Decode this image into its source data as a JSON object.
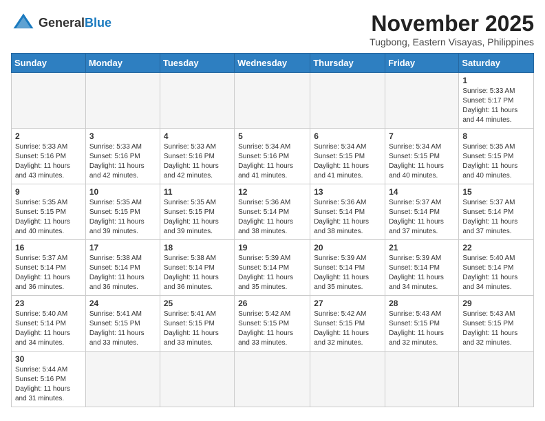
{
  "header": {
    "logo_general": "General",
    "logo_blue": "Blue",
    "month_year": "November 2025",
    "location": "Tugbong, Eastern Visayas, Philippines"
  },
  "weekdays": [
    "Sunday",
    "Monday",
    "Tuesday",
    "Wednesday",
    "Thursday",
    "Friday",
    "Saturday"
  ],
  "weeks": [
    [
      {
        "day": "",
        "info": ""
      },
      {
        "day": "",
        "info": ""
      },
      {
        "day": "",
        "info": ""
      },
      {
        "day": "",
        "info": ""
      },
      {
        "day": "",
        "info": ""
      },
      {
        "day": "",
        "info": ""
      },
      {
        "day": "1",
        "info": "Sunrise: 5:33 AM\nSunset: 5:17 PM\nDaylight: 11 hours\nand 44 minutes."
      }
    ],
    [
      {
        "day": "2",
        "info": "Sunrise: 5:33 AM\nSunset: 5:16 PM\nDaylight: 11 hours\nand 43 minutes."
      },
      {
        "day": "3",
        "info": "Sunrise: 5:33 AM\nSunset: 5:16 PM\nDaylight: 11 hours\nand 42 minutes."
      },
      {
        "day": "4",
        "info": "Sunrise: 5:33 AM\nSunset: 5:16 PM\nDaylight: 11 hours\nand 42 minutes."
      },
      {
        "day": "5",
        "info": "Sunrise: 5:34 AM\nSunset: 5:16 PM\nDaylight: 11 hours\nand 41 minutes."
      },
      {
        "day": "6",
        "info": "Sunrise: 5:34 AM\nSunset: 5:15 PM\nDaylight: 11 hours\nand 41 minutes."
      },
      {
        "day": "7",
        "info": "Sunrise: 5:34 AM\nSunset: 5:15 PM\nDaylight: 11 hours\nand 40 minutes."
      },
      {
        "day": "8",
        "info": "Sunrise: 5:35 AM\nSunset: 5:15 PM\nDaylight: 11 hours\nand 40 minutes."
      }
    ],
    [
      {
        "day": "9",
        "info": "Sunrise: 5:35 AM\nSunset: 5:15 PM\nDaylight: 11 hours\nand 40 minutes."
      },
      {
        "day": "10",
        "info": "Sunrise: 5:35 AM\nSunset: 5:15 PM\nDaylight: 11 hours\nand 39 minutes."
      },
      {
        "day": "11",
        "info": "Sunrise: 5:35 AM\nSunset: 5:15 PM\nDaylight: 11 hours\nand 39 minutes."
      },
      {
        "day": "12",
        "info": "Sunrise: 5:36 AM\nSunset: 5:14 PM\nDaylight: 11 hours\nand 38 minutes."
      },
      {
        "day": "13",
        "info": "Sunrise: 5:36 AM\nSunset: 5:14 PM\nDaylight: 11 hours\nand 38 minutes."
      },
      {
        "day": "14",
        "info": "Sunrise: 5:37 AM\nSunset: 5:14 PM\nDaylight: 11 hours\nand 37 minutes."
      },
      {
        "day": "15",
        "info": "Sunrise: 5:37 AM\nSunset: 5:14 PM\nDaylight: 11 hours\nand 37 minutes."
      }
    ],
    [
      {
        "day": "16",
        "info": "Sunrise: 5:37 AM\nSunset: 5:14 PM\nDaylight: 11 hours\nand 36 minutes."
      },
      {
        "day": "17",
        "info": "Sunrise: 5:38 AM\nSunset: 5:14 PM\nDaylight: 11 hours\nand 36 minutes."
      },
      {
        "day": "18",
        "info": "Sunrise: 5:38 AM\nSunset: 5:14 PM\nDaylight: 11 hours\nand 36 minutes."
      },
      {
        "day": "19",
        "info": "Sunrise: 5:39 AM\nSunset: 5:14 PM\nDaylight: 11 hours\nand 35 minutes."
      },
      {
        "day": "20",
        "info": "Sunrise: 5:39 AM\nSunset: 5:14 PM\nDaylight: 11 hours\nand 35 minutes."
      },
      {
        "day": "21",
        "info": "Sunrise: 5:39 AM\nSunset: 5:14 PM\nDaylight: 11 hours\nand 34 minutes."
      },
      {
        "day": "22",
        "info": "Sunrise: 5:40 AM\nSunset: 5:14 PM\nDaylight: 11 hours\nand 34 minutes."
      }
    ],
    [
      {
        "day": "23",
        "info": "Sunrise: 5:40 AM\nSunset: 5:14 PM\nDaylight: 11 hours\nand 34 minutes."
      },
      {
        "day": "24",
        "info": "Sunrise: 5:41 AM\nSunset: 5:15 PM\nDaylight: 11 hours\nand 33 minutes."
      },
      {
        "day": "25",
        "info": "Sunrise: 5:41 AM\nSunset: 5:15 PM\nDaylight: 11 hours\nand 33 minutes."
      },
      {
        "day": "26",
        "info": "Sunrise: 5:42 AM\nSunset: 5:15 PM\nDaylight: 11 hours\nand 33 minutes."
      },
      {
        "day": "27",
        "info": "Sunrise: 5:42 AM\nSunset: 5:15 PM\nDaylight: 11 hours\nand 32 minutes."
      },
      {
        "day": "28",
        "info": "Sunrise: 5:43 AM\nSunset: 5:15 PM\nDaylight: 11 hours\nand 32 minutes."
      },
      {
        "day": "29",
        "info": "Sunrise: 5:43 AM\nSunset: 5:15 PM\nDaylight: 11 hours\nand 32 minutes."
      }
    ],
    [
      {
        "day": "30",
        "info": "Sunrise: 5:44 AM\nSunset: 5:16 PM\nDaylight: 11 hours\nand 31 minutes."
      },
      {
        "day": "",
        "info": ""
      },
      {
        "day": "",
        "info": ""
      },
      {
        "day": "",
        "info": ""
      },
      {
        "day": "",
        "info": ""
      },
      {
        "day": "",
        "info": ""
      },
      {
        "day": "",
        "info": ""
      }
    ]
  ]
}
